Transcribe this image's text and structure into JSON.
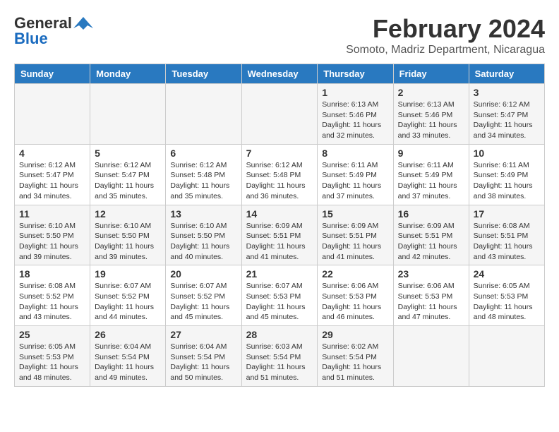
{
  "logo": {
    "general": "General",
    "blue": "Blue"
  },
  "header": {
    "month_year": "February 2024",
    "location": "Somoto, Madriz Department, Nicaragua"
  },
  "weekdays": [
    "Sunday",
    "Monday",
    "Tuesday",
    "Wednesday",
    "Thursday",
    "Friday",
    "Saturday"
  ],
  "weeks": [
    [
      {
        "day": "",
        "sunrise": "",
        "sunset": "",
        "daylight": ""
      },
      {
        "day": "",
        "sunrise": "",
        "sunset": "",
        "daylight": ""
      },
      {
        "day": "",
        "sunrise": "",
        "sunset": "",
        "daylight": ""
      },
      {
        "day": "",
        "sunrise": "",
        "sunset": "",
        "daylight": ""
      },
      {
        "day": "1",
        "sunrise": "Sunrise: 6:13 AM",
        "sunset": "Sunset: 5:46 PM",
        "daylight": "Daylight: 11 hours and 32 minutes."
      },
      {
        "day": "2",
        "sunrise": "Sunrise: 6:13 AM",
        "sunset": "Sunset: 5:46 PM",
        "daylight": "Daylight: 11 hours and 33 minutes."
      },
      {
        "day": "3",
        "sunrise": "Sunrise: 6:12 AM",
        "sunset": "Sunset: 5:47 PM",
        "daylight": "Daylight: 11 hours and 34 minutes."
      }
    ],
    [
      {
        "day": "4",
        "sunrise": "Sunrise: 6:12 AM",
        "sunset": "Sunset: 5:47 PM",
        "daylight": "Daylight: 11 hours and 34 minutes."
      },
      {
        "day": "5",
        "sunrise": "Sunrise: 6:12 AM",
        "sunset": "Sunset: 5:47 PM",
        "daylight": "Daylight: 11 hours and 35 minutes."
      },
      {
        "day": "6",
        "sunrise": "Sunrise: 6:12 AM",
        "sunset": "Sunset: 5:48 PM",
        "daylight": "Daylight: 11 hours and 35 minutes."
      },
      {
        "day": "7",
        "sunrise": "Sunrise: 6:12 AM",
        "sunset": "Sunset: 5:48 PM",
        "daylight": "Daylight: 11 hours and 36 minutes."
      },
      {
        "day": "8",
        "sunrise": "Sunrise: 6:11 AM",
        "sunset": "Sunset: 5:49 PM",
        "daylight": "Daylight: 11 hours and 37 minutes."
      },
      {
        "day": "9",
        "sunrise": "Sunrise: 6:11 AM",
        "sunset": "Sunset: 5:49 PM",
        "daylight": "Daylight: 11 hours and 37 minutes."
      },
      {
        "day": "10",
        "sunrise": "Sunrise: 6:11 AM",
        "sunset": "Sunset: 5:49 PM",
        "daylight": "Daylight: 11 hours and 38 minutes."
      }
    ],
    [
      {
        "day": "11",
        "sunrise": "Sunrise: 6:10 AM",
        "sunset": "Sunset: 5:50 PM",
        "daylight": "Daylight: 11 hours and 39 minutes."
      },
      {
        "day": "12",
        "sunrise": "Sunrise: 6:10 AM",
        "sunset": "Sunset: 5:50 PM",
        "daylight": "Daylight: 11 hours and 39 minutes."
      },
      {
        "day": "13",
        "sunrise": "Sunrise: 6:10 AM",
        "sunset": "Sunset: 5:50 PM",
        "daylight": "Daylight: 11 hours and 40 minutes."
      },
      {
        "day": "14",
        "sunrise": "Sunrise: 6:09 AM",
        "sunset": "Sunset: 5:51 PM",
        "daylight": "Daylight: 11 hours and 41 minutes."
      },
      {
        "day": "15",
        "sunrise": "Sunrise: 6:09 AM",
        "sunset": "Sunset: 5:51 PM",
        "daylight": "Daylight: 11 hours and 41 minutes."
      },
      {
        "day": "16",
        "sunrise": "Sunrise: 6:09 AM",
        "sunset": "Sunset: 5:51 PM",
        "daylight": "Daylight: 11 hours and 42 minutes."
      },
      {
        "day": "17",
        "sunrise": "Sunrise: 6:08 AM",
        "sunset": "Sunset: 5:51 PM",
        "daylight": "Daylight: 11 hours and 43 minutes."
      }
    ],
    [
      {
        "day": "18",
        "sunrise": "Sunrise: 6:08 AM",
        "sunset": "Sunset: 5:52 PM",
        "daylight": "Daylight: 11 hours and 43 minutes."
      },
      {
        "day": "19",
        "sunrise": "Sunrise: 6:07 AM",
        "sunset": "Sunset: 5:52 PM",
        "daylight": "Daylight: 11 hours and 44 minutes."
      },
      {
        "day": "20",
        "sunrise": "Sunrise: 6:07 AM",
        "sunset": "Sunset: 5:52 PM",
        "daylight": "Daylight: 11 hours and 45 minutes."
      },
      {
        "day": "21",
        "sunrise": "Sunrise: 6:07 AM",
        "sunset": "Sunset: 5:53 PM",
        "daylight": "Daylight: 11 hours and 45 minutes."
      },
      {
        "day": "22",
        "sunrise": "Sunrise: 6:06 AM",
        "sunset": "Sunset: 5:53 PM",
        "daylight": "Daylight: 11 hours and 46 minutes."
      },
      {
        "day": "23",
        "sunrise": "Sunrise: 6:06 AM",
        "sunset": "Sunset: 5:53 PM",
        "daylight": "Daylight: 11 hours and 47 minutes."
      },
      {
        "day": "24",
        "sunrise": "Sunrise: 6:05 AM",
        "sunset": "Sunset: 5:53 PM",
        "daylight": "Daylight: 11 hours and 48 minutes."
      }
    ],
    [
      {
        "day": "25",
        "sunrise": "Sunrise: 6:05 AM",
        "sunset": "Sunset: 5:53 PM",
        "daylight": "Daylight: 11 hours and 48 minutes."
      },
      {
        "day": "26",
        "sunrise": "Sunrise: 6:04 AM",
        "sunset": "Sunset: 5:54 PM",
        "daylight": "Daylight: 11 hours and 49 minutes."
      },
      {
        "day": "27",
        "sunrise": "Sunrise: 6:04 AM",
        "sunset": "Sunset: 5:54 PM",
        "daylight": "Daylight: 11 hours and 50 minutes."
      },
      {
        "day": "28",
        "sunrise": "Sunrise: 6:03 AM",
        "sunset": "Sunset: 5:54 PM",
        "daylight": "Daylight: 11 hours and 51 minutes."
      },
      {
        "day": "29",
        "sunrise": "Sunrise: 6:02 AM",
        "sunset": "Sunset: 5:54 PM",
        "daylight": "Daylight: 11 hours and 51 minutes."
      },
      {
        "day": "",
        "sunrise": "",
        "sunset": "",
        "daylight": ""
      },
      {
        "day": "",
        "sunrise": "",
        "sunset": "",
        "daylight": ""
      }
    ]
  ]
}
